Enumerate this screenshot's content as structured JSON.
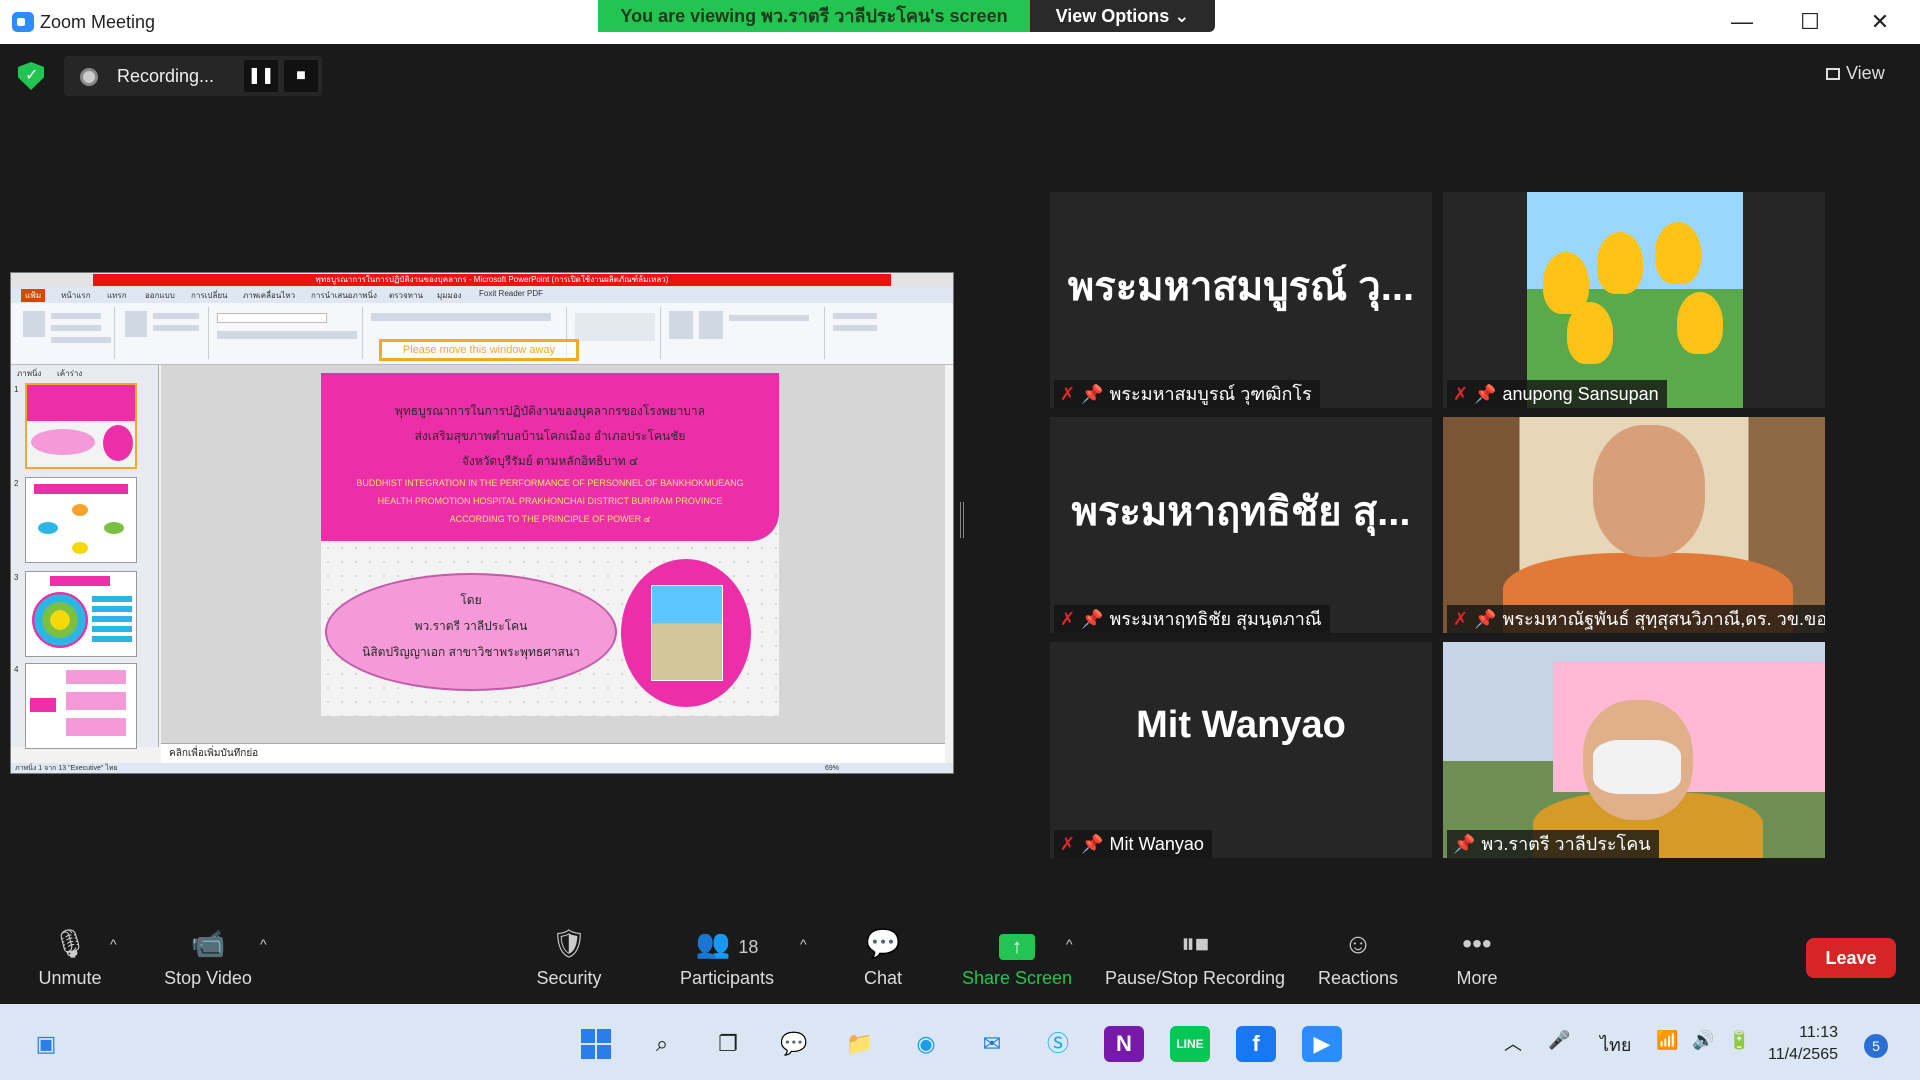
{
  "window": {
    "title": "Zoom Meeting"
  },
  "share_banner": {
    "text": "You are viewing พว.ราตรี  วาลีประโคน's screen",
    "view_options": "View Options ⌄"
  },
  "window_controls": {
    "minimize": "—",
    "maximize": "☐",
    "close": "✕"
  },
  "recording": {
    "label": "Recording...",
    "pause": "❚❚",
    "stop": "■"
  },
  "view_button": {
    "label": "View"
  },
  "shared_screen": {
    "ppt_title": "พุทธบูรณาการในการปฏิบัติงานของบุคลากร - Microsoft PowerPoint (การเปิดใช้งานผลิตภัณฑ์ล้มเหลว)",
    "ribbon_tabs": [
      "แฟ้ม",
      "หน้าแรก",
      "แทรก",
      "ออกแบบ",
      "การเปลี่ยน",
      "ภาพเคลื่อนไหว",
      "การนำเสนอภาพนิ่ง",
      "ตรวจทาน",
      "มุมมอง",
      "Foxit Reader PDF"
    ],
    "warning": "Please move this window away",
    "panel_tabs": [
      "ภาพนิ่ง",
      "เค้าร่าง"
    ],
    "slide_numbers": [
      "1",
      "2",
      "3",
      "4"
    ],
    "slide_title_th": [
      "พุทธบูรณาการในการปฏิบัติงานของบุคลากรของโรงพยาบาล",
      "ส่งเสริมสุขภาพตำบลบ้านโคกเมือง  อำเภอประโคนชัย",
      "จังหวัดบุรีรัมย์  ตามหลักอิทธิบาท ๔"
    ],
    "slide_title_en": [
      "BUDDHIST INTEGRATION IN THE PERFORMANCE OF PERSONNEL OF BANKHOKMUEANG",
      "HEALTH PROMOTION HOSPITAL PRAKHONCHAI DISTRICT BURIRAM PROVINCE",
      "ACCORDING TO THE PRINCIPLE OF POWER ๔"
    ],
    "cloud_text": [
      "โดย",
      "พว.ราตรี  วาลีประโคน",
      "นิสิตปริญญาเอก สาขาวิชาพระพุทธศาสนา"
    ],
    "notes_placeholder": "คลิกเพื่อเพิ่มบันทึกย่อ",
    "status": "ภาพนิ่ง 1 จาก 13    \"Executive\"    ไทย",
    "zoom": "69%"
  },
  "participants": [
    {
      "big_name": "พระมหาสมบูรณ์ วุ...",
      "name": "พระมหาสมบูรณ์ วุฑฒิกโร",
      "muted": true
    },
    {
      "big_name": "",
      "name": "anupong Sansupan",
      "muted": true
    },
    {
      "big_name": "พระมหาฤทธิชัย สุ...",
      "name": "พระมหาฤทธิชัย สุมนฺตภาณี",
      "muted": true
    },
    {
      "big_name": "",
      "name": "พระมหาณัฐพันธ์ สุทฺสุสนวิภาณี,ดร. วข.ขอ...",
      "muted": true
    },
    {
      "big_name": "Mit Wanyao",
      "name": "Mit Wanyao",
      "muted": true
    },
    {
      "big_name": "",
      "name": "พว.ราตรี  วาลีประโคน",
      "muted": false
    }
  ],
  "toolbar": {
    "unmute": "Unmute",
    "stop_video": "Stop Video",
    "security": "Security",
    "participants": "Participants",
    "participant_count": "18",
    "chat": "Chat",
    "share_screen": "Share Screen",
    "pause_stop_recording": "Pause/Stop Recording",
    "reactions": "Reactions",
    "more": "More",
    "leave": "Leave"
  },
  "taskbar": {
    "language": "ไทย",
    "time": "11:13",
    "date": "11/4/2565",
    "notifications": "5"
  },
  "colors": {
    "accent_green": "#23c552",
    "leave_red": "#d92426",
    "muted_red": "#e02828",
    "slide_pink": "#ec2ea8"
  }
}
